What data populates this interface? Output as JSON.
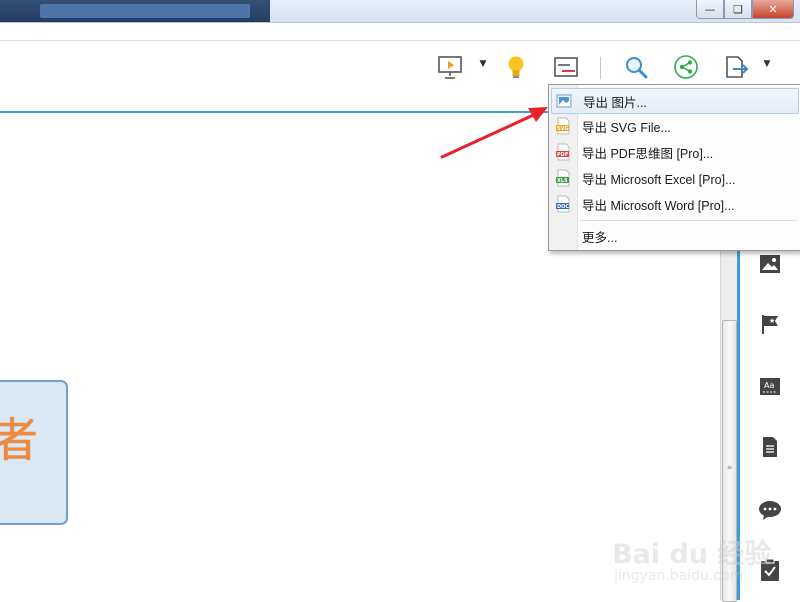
{
  "export_menu": {
    "items": [
      {
        "label": "导出 图片...",
        "icon": "image-file-icon",
        "tag": ""
      },
      {
        "label": "导出 SVG File...",
        "icon": "svg-file-icon",
        "tag": "SVG"
      },
      {
        "label": "导出 PDF思维图 [Pro]...",
        "icon": "pdf-file-icon",
        "tag": "PDF"
      },
      {
        "label": "导出 Microsoft Excel [Pro]...",
        "icon": "excel-file-icon",
        "tag": "XLS"
      },
      {
        "label": "导出 Microsoft Word [Pro]...",
        "icon": "word-file-icon",
        "tag": "DOC"
      }
    ],
    "more_label": "更多..."
  },
  "canvas": {
    "node_text": "者"
  },
  "watermark": {
    "main": "Bai du 经验",
    "sub": "jingyan.baidu.com"
  },
  "colors": {
    "accent": "#3a9fd8",
    "arrow": "#e8202a",
    "node_fill": "#dde8f5",
    "node_border": "#6f9fd8",
    "node_text": "#f08a3c"
  }
}
